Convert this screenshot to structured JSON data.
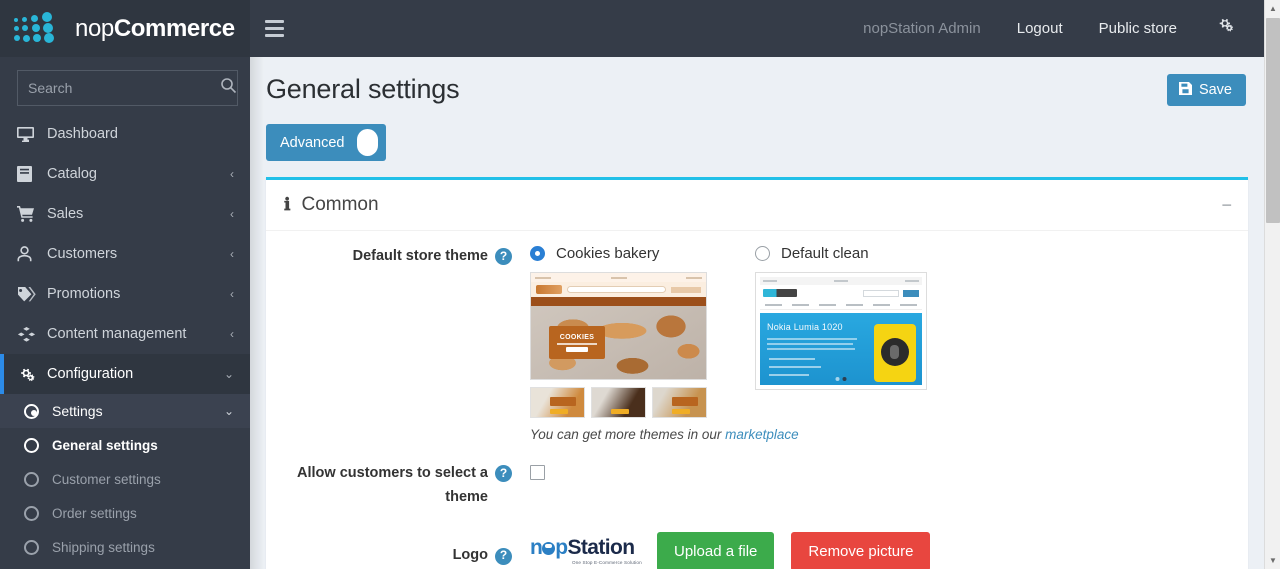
{
  "brand": {
    "name_light": "nop",
    "name_bold": "Commerce",
    "logo_icon": "nopcommerce-dots-logo"
  },
  "topnav": {
    "hamburger_icon": "hamburger-menu-icon",
    "user": "nopStation Admin",
    "logout": "Logout",
    "public_store": "Public store",
    "gear_icon": "gear-settings-icon"
  },
  "sidebar": {
    "search_placeholder": "Search",
    "search_value": "",
    "search_icon": "search-icon",
    "items": [
      {
        "label": "Dashboard",
        "icon": "monitor-icon",
        "arrow": ""
      },
      {
        "label": "Catalog",
        "icon": "book-icon",
        "arrow": "‹"
      },
      {
        "label": "Sales",
        "icon": "shopping-cart-icon",
        "arrow": "‹"
      },
      {
        "label": "Customers",
        "icon": "user-icon",
        "arrow": "‹"
      },
      {
        "label": "Promotions",
        "icon": "tags-icon",
        "arrow": "‹"
      },
      {
        "label": "Content management",
        "icon": "cubes-icon",
        "arrow": "‹"
      },
      {
        "label": "Configuration",
        "icon": "cogs-icon",
        "arrow": "⌄"
      }
    ],
    "settings_group": {
      "label": "Settings",
      "icon": "dot-circle-icon",
      "arrow": "⌄"
    },
    "settings_items": [
      {
        "label": "General settings",
        "icon": "circle-icon",
        "active": true
      },
      {
        "label": "Customer settings",
        "icon": "circle-icon",
        "active": false
      },
      {
        "label": "Order settings",
        "icon": "circle-icon",
        "active": false
      },
      {
        "label": "Shipping settings",
        "icon": "circle-icon",
        "active": false
      }
    ]
  },
  "page": {
    "title": "General settings",
    "save_label": "Save",
    "save_icon": "floppy-disk-icon",
    "advanced_label": "Advanced",
    "advanced_on": true
  },
  "panel": {
    "title": "Common",
    "info_icon": "info-icon",
    "collapse_icon": "minimize-icon"
  },
  "form": {
    "default_store_theme": {
      "label": "Default store theme",
      "help_icon": "question-mark-icon",
      "options": [
        {
          "name": "Cookies bakery",
          "selected": true,
          "preview": "cookies-bakery-theme-preview"
        },
        {
          "name": "Default clean",
          "selected": false,
          "preview": "default-clean-theme-preview"
        }
      ],
      "note_prefix": "You can get more themes in our ",
      "note_link": "marketplace"
    },
    "allow_customers_select_theme": {
      "label": "Allow customers to select a theme",
      "help_icon": "question-mark-icon",
      "checked": false
    },
    "logo": {
      "label": "Logo",
      "help_icon": "question-mark-icon",
      "image_name": "nopstation-logo",
      "image_word_1": "n",
      "image_word_2": "p",
      "image_word_3": "Station",
      "image_tagline": "One Stop E-Commerce Solution",
      "upload_label": "Upload a file",
      "remove_label": "Remove picture"
    }
  },
  "theme_previews": {
    "cookies_bakery": {
      "hero_card_title": "COOKIES"
    },
    "default_clean": {
      "hero_title": "Nokia Lumia 1020"
    }
  },
  "scrollbar": {
    "up_icon": "scroll-up-arrow-icon",
    "down_icon": "scroll-down-arrow-icon"
  }
}
